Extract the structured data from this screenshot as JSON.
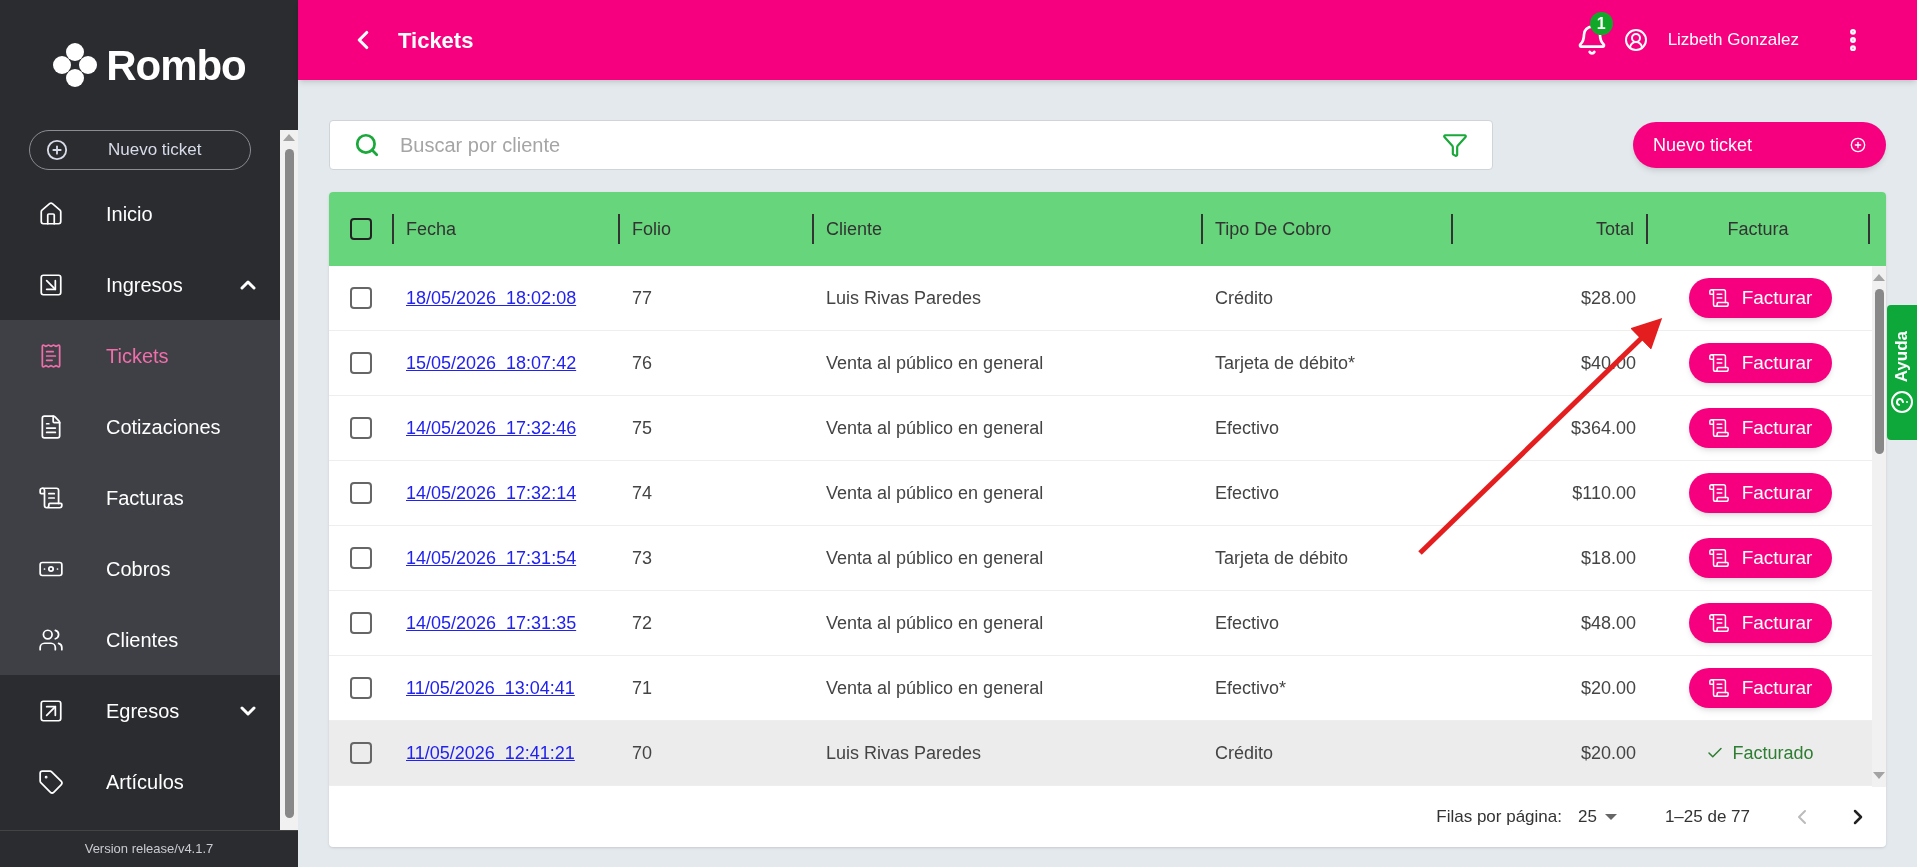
{
  "sidebar": {
    "logo": "Rombo",
    "new_button": "Nuevo ticket",
    "items": [
      {
        "label": "Inicio",
        "selected": false,
        "sub": false
      },
      {
        "label": "Ingresos",
        "selected": false,
        "expanded": true,
        "sub": false
      },
      {
        "label": "Tickets",
        "selected": true,
        "sub": true
      },
      {
        "label": "Cotizaciones",
        "selected": false,
        "sub": true
      },
      {
        "label": "Facturas",
        "selected": false,
        "sub": true
      },
      {
        "label": "Cobros",
        "selected": false,
        "sub": true
      },
      {
        "label": "Clientes",
        "selected": false,
        "sub": true
      },
      {
        "label": "Egresos",
        "selected": false,
        "expanded": false,
        "sub": false
      },
      {
        "label": "Artículos",
        "selected": false,
        "sub": false
      }
    ],
    "version": "Version release/v4.1.7"
  },
  "header": {
    "title": "Tickets",
    "notifications": "1",
    "user": "Lizbeth Gonzalez"
  },
  "search": {
    "placeholder": "Buscar por cliente"
  },
  "new_ticket_button": "Nuevo ticket",
  "table": {
    "all_checked": false,
    "columns": [
      "Fecha",
      "Folio",
      "Cliente",
      "Tipo De Cobro",
      "Total",
      "Factura"
    ],
    "rows": [
      {
        "checked": false,
        "hovered": false,
        "fecha": "18/05/2026  18:02:08",
        "folio": "77",
        "cliente": "Luis Rivas Paredes",
        "tipo": "Crédito",
        "total": "$28.00",
        "factura": {
          "kind": "button",
          "label": "Facturar"
        }
      },
      {
        "checked": false,
        "hovered": false,
        "fecha": "15/05/2026  18:07:42",
        "folio": "76",
        "cliente": "Venta al público en general",
        "tipo": "Tarjeta de débito*",
        "total": "$40.00",
        "factura": {
          "kind": "button",
          "label": "Facturar"
        }
      },
      {
        "checked": false,
        "hovered": false,
        "fecha": "14/05/2026  17:32:46",
        "folio": "75",
        "cliente": "Venta al público en general",
        "tipo": "Efectivo",
        "total": "$364.00",
        "factura": {
          "kind": "button",
          "label": "Facturar"
        }
      },
      {
        "checked": false,
        "hovered": false,
        "fecha": "14/05/2026  17:32:14",
        "folio": "74",
        "cliente": "Venta al público en general",
        "tipo": "Efectivo",
        "total": "$110.00",
        "factura": {
          "kind": "button",
          "label": "Facturar"
        }
      },
      {
        "checked": false,
        "hovered": false,
        "fecha": "14/05/2026  17:31:54",
        "folio": "73",
        "cliente": "Venta al público en general",
        "tipo": "Tarjeta de débito",
        "total": "$18.00",
        "factura": {
          "kind": "button",
          "label": "Facturar"
        }
      },
      {
        "checked": false,
        "hovered": false,
        "fecha": "14/05/2026  17:31:35",
        "folio": "72",
        "cliente": "Venta al público en general",
        "tipo": "Efectivo",
        "total": "$48.00",
        "factura": {
          "kind": "button",
          "label": "Facturar"
        }
      },
      {
        "checked": false,
        "hovered": false,
        "fecha": "11/05/2026  13:04:41",
        "folio": "71",
        "cliente": "Venta al público en general",
        "tipo": "Efectivo*",
        "total": "$20.00",
        "factura": {
          "kind": "button",
          "label": "Facturar"
        }
      },
      {
        "checked": false,
        "hovered": true,
        "fecha": "11/05/2026  12:41:21",
        "folio": "70",
        "cliente": "Luis Rivas Paredes",
        "tipo": "Crédito",
        "total": "$20.00",
        "factura": {
          "kind": "done",
          "label": "Facturado"
        }
      }
    ],
    "pagination": {
      "rows_label": "Filas por página:",
      "rows_value": "25",
      "range": "1–25 de 77"
    }
  },
  "help_tab": "Ayuda"
}
